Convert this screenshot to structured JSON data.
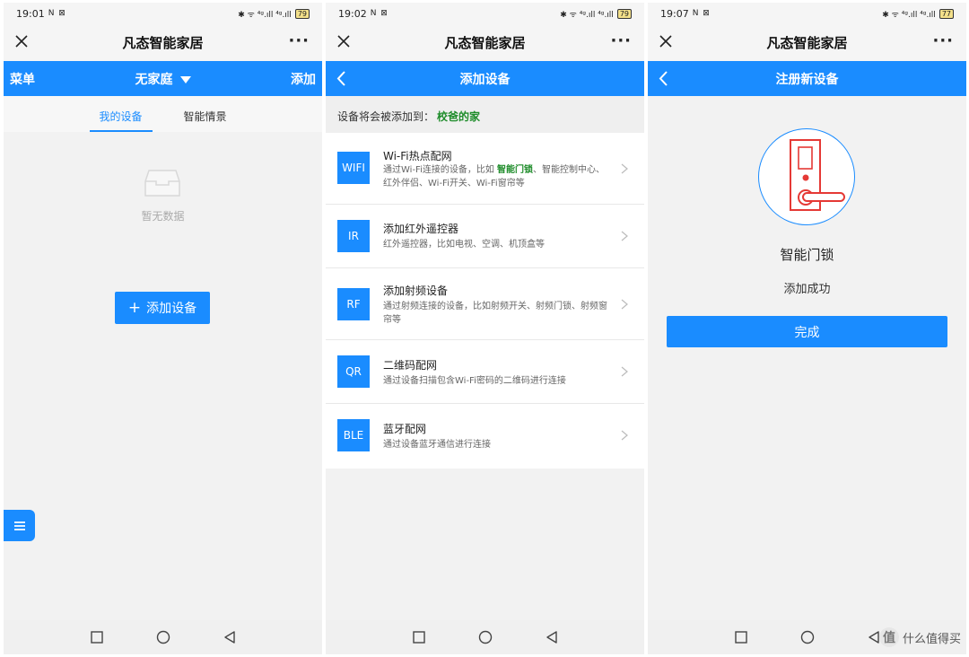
{
  "screens": [
    {
      "status": {
        "time": "19:01",
        "left_icons": "N ⊠",
        "right_icons": "✱ ᯤ ⁴ᵍ.ıll ⁴ᵍ.ıll",
        "battery": "79"
      },
      "wx_title": "凡态智能家居",
      "header": {
        "left": "菜单",
        "center": "无家庭",
        "right": "添加"
      },
      "tabs": [
        "我的设备",
        "智能情景"
      ],
      "empty_text": "暂无数据",
      "add_button": "添加设备"
    },
    {
      "status": {
        "time": "19:02",
        "left_icons": "N ⊠",
        "right_icons": "✱ ᯤ ⁴ᵍ.ıll ⁴ᵍ.ıll",
        "battery": "79"
      },
      "wx_title": "凡态智能家居",
      "header": {
        "title": "添加设备"
      },
      "hint": {
        "prefix": "设备将会被添加到：",
        "home": "校爸的家"
      },
      "items": [
        {
          "badge": "WIFI",
          "title": "Wi-Fi热点配网",
          "desc_pre": "通过Wi-Fi连接的设备，比如 ",
          "desc_hl": "智能门锁",
          "desc_post": "、智能控制中心、红外伴侣、Wi-Fi开关、Wi-Fi窗帘等"
        },
        {
          "badge": "IR",
          "title": "添加红外遥控器",
          "desc_pre": "红外遥控器，比如电视、空调、机顶盒等",
          "desc_hl": "",
          "desc_post": ""
        },
        {
          "badge": "RF",
          "title": "添加射频设备",
          "desc_pre": "通过射频连接的设备，比如射频开关、射频门锁、射频窗帘等",
          "desc_hl": "",
          "desc_post": ""
        },
        {
          "badge": "QR",
          "title": "二维码配网",
          "desc_pre": "通过设备扫描包含Wi-Fi密码的二维码进行连接",
          "desc_hl": "",
          "desc_post": ""
        },
        {
          "badge": "BLE",
          "title": "蓝牙配网",
          "desc_pre": "通过设备蓝牙通信进行连接",
          "desc_hl": "",
          "desc_post": ""
        }
      ]
    },
    {
      "status": {
        "time": "19:07",
        "left_icons": "N ⊠",
        "right_icons": "✱ ᯤ ⁴ᵍ.ıll ⁴ᵍ.ıll",
        "battery": "77"
      },
      "wx_title": "凡态智能家居",
      "header": {
        "title": "注册新设备"
      },
      "device_name": "智能门锁",
      "device_status": "添加成功",
      "done_button": "完成",
      "watermark": "什么值得买"
    }
  ],
  "colors": {
    "primary": "#1a8cff",
    "highlight": "#1e8c2a",
    "lock": "#e53935"
  }
}
